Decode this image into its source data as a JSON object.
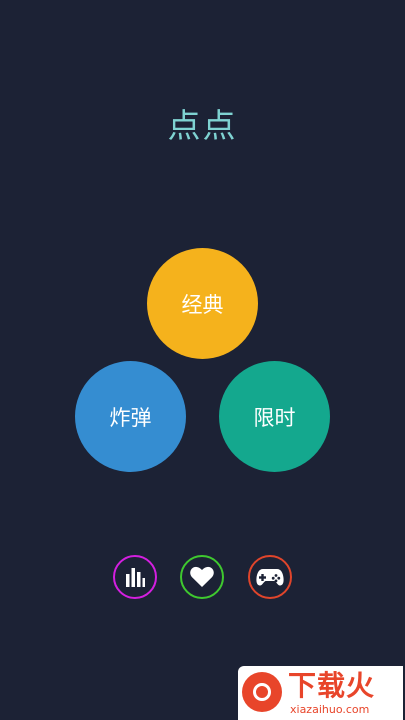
{
  "app": {
    "title": "点点"
  },
  "modes": {
    "classic": "经典",
    "bomb": "炸弹",
    "timed": "限时"
  },
  "bottom_icons": [
    {
      "icon": "bar-chart-icon",
      "color": "#d41fe0"
    },
    {
      "icon": "heart-icon",
      "color": "#3fc92f"
    },
    {
      "icon": "gamepad-icon",
      "color": "#e0452b"
    }
  ],
  "colors": {
    "background": "#1c2235",
    "title": "#7fd3d2",
    "classic": "#f5b21c",
    "bomb": "#358dd1",
    "timed": "#14a88e"
  },
  "watermark": {
    "name": "下载火",
    "url": "xiazaihuo.com"
  }
}
